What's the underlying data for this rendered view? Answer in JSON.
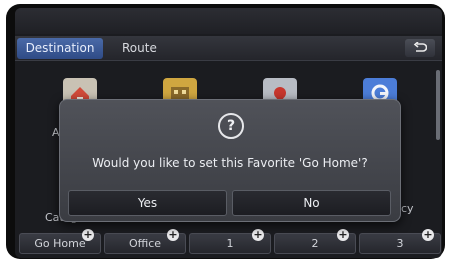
{
  "tabs": {
    "destination": "Destination",
    "route": "Route"
  },
  "background_labels": {
    "left_partial": "A",
    "category_partial": "Categ",
    "right_partial": "cy"
  },
  "favorites": [
    {
      "label": "Go Home"
    },
    {
      "label": "Office"
    },
    {
      "label": "1"
    },
    {
      "label": "2"
    },
    {
      "label": "3"
    }
  ],
  "dialog": {
    "icon": "question-icon",
    "message": "Would you like to set this Favorite 'Go Home'?",
    "yes_label": "Yes",
    "no_label": "No"
  },
  "colors": {
    "active_tab": "#3c5a98",
    "dialog_bg": "#45474d"
  }
}
